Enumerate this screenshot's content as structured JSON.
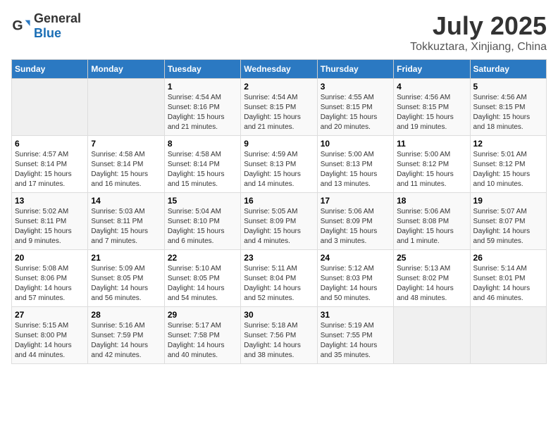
{
  "logo": {
    "general": "General",
    "blue": "Blue"
  },
  "title": "July 2025",
  "subtitle": "Tokkuztara, Xinjiang, China",
  "days_of_week": [
    "Sunday",
    "Monday",
    "Tuesday",
    "Wednesday",
    "Thursday",
    "Friday",
    "Saturday"
  ],
  "weeks": [
    [
      {
        "day": "",
        "info": ""
      },
      {
        "day": "",
        "info": ""
      },
      {
        "day": "1",
        "info": "Sunrise: 4:54 AM\nSunset: 8:16 PM\nDaylight: 15 hours and 21 minutes."
      },
      {
        "day": "2",
        "info": "Sunrise: 4:54 AM\nSunset: 8:15 PM\nDaylight: 15 hours and 21 minutes."
      },
      {
        "day": "3",
        "info": "Sunrise: 4:55 AM\nSunset: 8:15 PM\nDaylight: 15 hours and 20 minutes."
      },
      {
        "day": "4",
        "info": "Sunrise: 4:56 AM\nSunset: 8:15 PM\nDaylight: 15 hours and 19 minutes."
      },
      {
        "day": "5",
        "info": "Sunrise: 4:56 AM\nSunset: 8:15 PM\nDaylight: 15 hours and 18 minutes."
      }
    ],
    [
      {
        "day": "6",
        "info": "Sunrise: 4:57 AM\nSunset: 8:14 PM\nDaylight: 15 hours and 17 minutes."
      },
      {
        "day": "7",
        "info": "Sunrise: 4:58 AM\nSunset: 8:14 PM\nDaylight: 15 hours and 16 minutes."
      },
      {
        "day": "8",
        "info": "Sunrise: 4:58 AM\nSunset: 8:14 PM\nDaylight: 15 hours and 15 minutes."
      },
      {
        "day": "9",
        "info": "Sunrise: 4:59 AM\nSunset: 8:13 PM\nDaylight: 15 hours and 14 minutes."
      },
      {
        "day": "10",
        "info": "Sunrise: 5:00 AM\nSunset: 8:13 PM\nDaylight: 15 hours and 13 minutes."
      },
      {
        "day": "11",
        "info": "Sunrise: 5:00 AM\nSunset: 8:12 PM\nDaylight: 15 hours and 11 minutes."
      },
      {
        "day": "12",
        "info": "Sunrise: 5:01 AM\nSunset: 8:12 PM\nDaylight: 15 hours and 10 minutes."
      }
    ],
    [
      {
        "day": "13",
        "info": "Sunrise: 5:02 AM\nSunset: 8:11 PM\nDaylight: 15 hours and 9 minutes."
      },
      {
        "day": "14",
        "info": "Sunrise: 5:03 AM\nSunset: 8:11 PM\nDaylight: 15 hours and 7 minutes."
      },
      {
        "day": "15",
        "info": "Sunrise: 5:04 AM\nSunset: 8:10 PM\nDaylight: 15 hours and 6 minutes."
      },
      {
        "day": "16",
        "info": "Sunrise: 5:05 AM\nSunset: 8:09 PM\nDaylight: 15 hours and 4 minutes."
      },
      {
        "day": "17",
        "info": "Sunrise: 5:06 AM\nSunset: 8:09 PM\nDaylight: 15 hours and 3 minutes."
      },
      {
        "day": "18",
        "info": "Sunrise: 5:06 AM\nSunset: 8:08 PM\nDaylight: 15 hours and 1 minute."
      },
      {
        "day": "19",
        "info": "Sunrise: 5:07 AM\nSunset: 8:07 PM\nDaylight: 14 hours and 59 minutes."
      }
    ],
    [
      {
        "day": "20",
        "info": "Sunrise: 5:08 AM\nSunset: 8:06 PM\nDaylight: 14 hours and 57 minutes."
      },
      {
        "day": "21",
        "info": "Sunrise: 5:09 AM\nSunset: 8:05 PM\nDaylight: 14 hours and 56 minutes."
      },
      {
        "day": "22",
        "info": "Sunrise: 5:10 AM\nSunset: 8:05 PM\nDaylight: 14 hours and 54 minutes."
      },
      {
        "day": "23",
        "info": "Sunrise: 5:11 AM\nSunset: 8:04 PM\nDaylight: 14 hours and 52 minutes."
      },
      {
        "day": "24",
        "info": "Sunrise: 5:12 AM\nSunset: 8:03 PM\nDaylight: 14 hours and 50 minutes."
      },
      {
        "day": "25",
        "info": "Sunrise: 5:13 AM\nSunset: 8:02 PM\nDaylight: 14 hours and 48 minutes."
      },
      {
        "day": "26",
        "info": "Sunrise: 5:14 AM\nSunset: 8:01 PM\nDaylight: 14 hours and 46 minutes."
      }
    ],
    [
      {
        "day": "27",
        "info": "Sunrise: 5:15 AM\nSunset: 8:00 PM\nDaylight: 14 hours and 44 minutes."
      },
      {
        "day": "28",
        "info": "Sunrise: 5:16 AM\nSunset: 7:59 PM\nDaylight: 14 hours and 42 minutes."
      },
      {
        "day": "29",
        "info": "Sunrise: 5:17 AM\nSunset: 7:58 PM\nDaylight: 14 hours and 40 minutes."
      },
      {
        "day": "30",
        "info": "Sunrise: 5:18 AM\nSunset: 7:56 PM\nDaylight: 14 hours and 38 minutes."
      },
      {
        "day": "31",
        "info": "Sunrise: 5:19 AM\nSunset: 7:55 PM\nDaylight: 14 hours and 35 minutes."
      },
      {
        "day": "",
        "info": ""
      },
      {
        "day": "",
        "info": ""
      }
    ]
  ]
}
